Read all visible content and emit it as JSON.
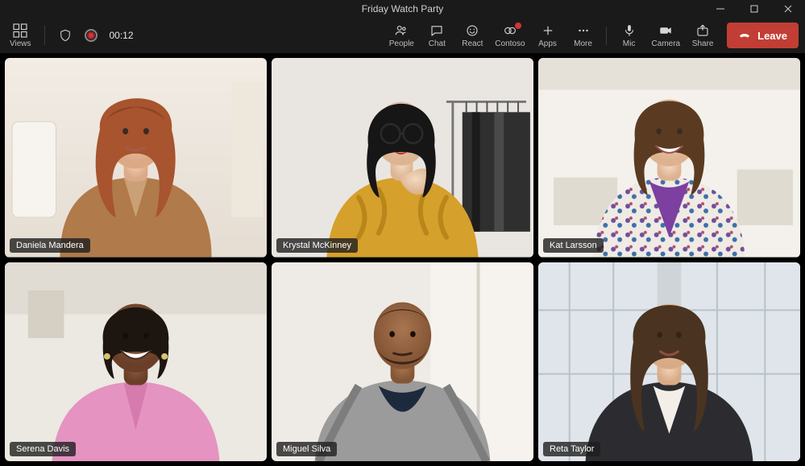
{
  "window": {
    "title": "Friday Watch Party"
  },
  "toolbar": {
    "views_label": "Views",
    "timer": "00:12",
    "actions": {
      "people": "People",
      "chat": "Chat",
      "react": "React",
      "contoso": "Contoso",
      "apps": "Apps",
      "more": "More",
      "mic": "Mic",
      "camera": "Camera",
      "share": "Share"
    },
    "leave_label": "Leave"
  },
  "participants": [
    {
      "name": "Daniela Mandera"
    },
    {
      "name": "Krystal McKinney"
    },
    {
      "name": "Kat Larsson"
    },
    {
      "name": "Serena Davis"
    },
    {
      "name": "Miguel Silva"
    },
    {
      "name": "Reta Taylor"
    }
  ]
}
